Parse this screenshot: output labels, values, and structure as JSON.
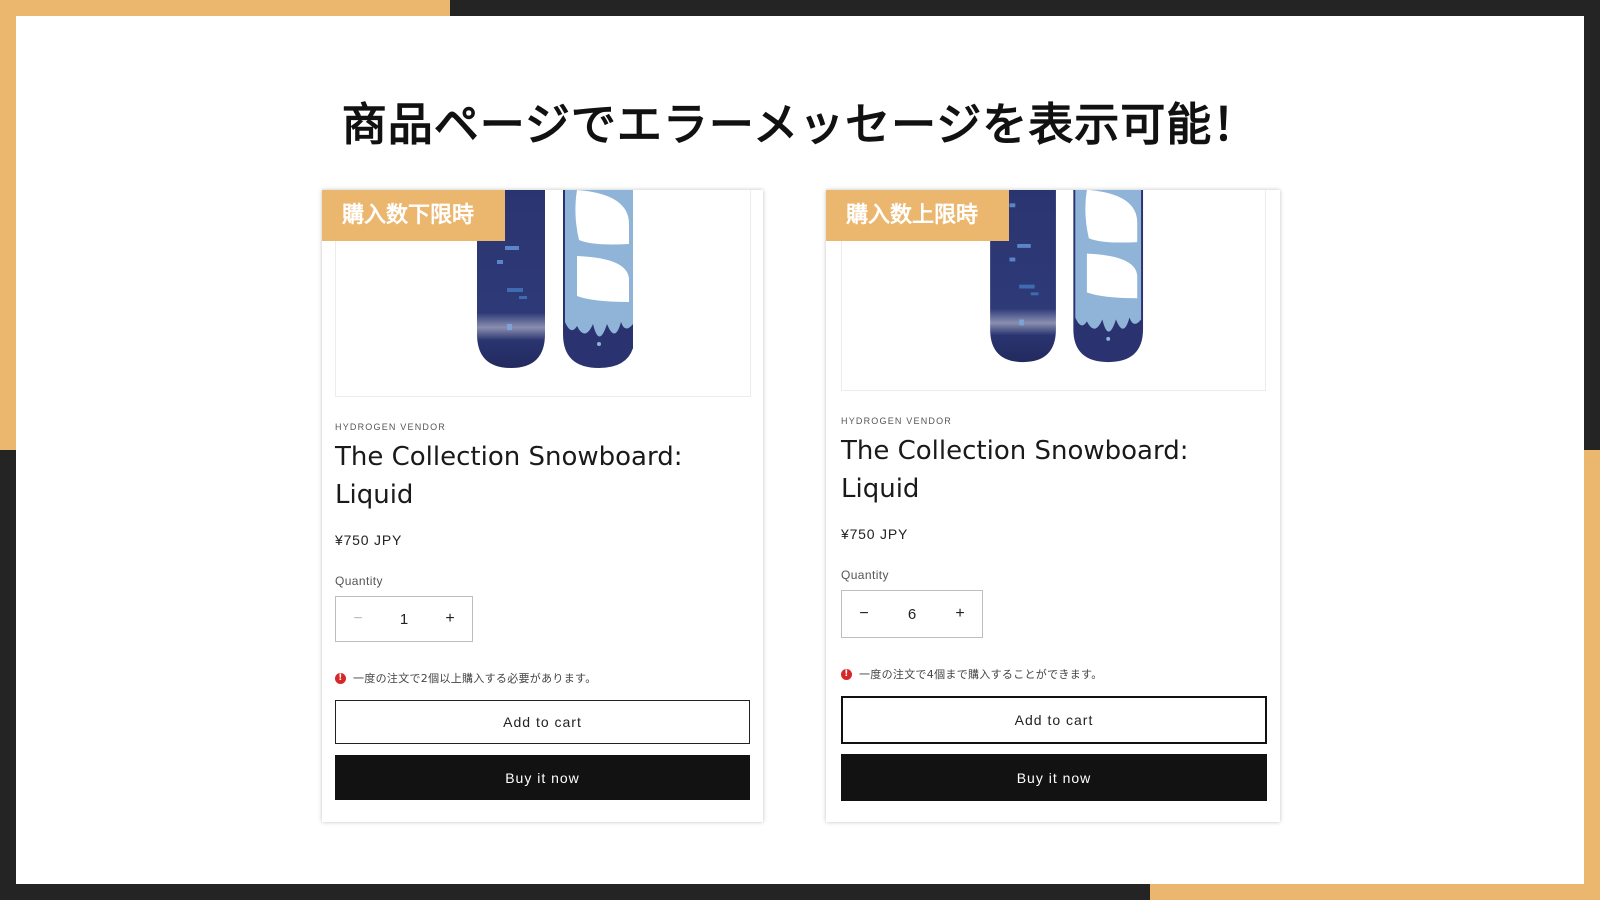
{
  "slide": {
    "title": "商品ページでエラーメッセージを表示可能！"
  },
  "cards": [
    {
      "ribbon": "購入数下限時",
      "vendor": "HYDROGEN VENDOR",
      "product_title": "The Collection Snowboard: Liquid",
      "price": "¥750 JPY",
      "quantity_label": "Quantity",
      "quantity_value": "1",
      "decrement": "−",
      "increment": "+",
      "error_message": "一度の注文で2個以上購入する必要があります。",
      "add_to_cart": "Add to cart",
      "buy_now": "Buy it now"
    },
    {
      "ribbon": "購入数上限時",
      "vendor": "HYDROGEN VENDOR",
      "product_title": "The Collection Snowboard: Liquid",
      "price": "¥750 JPY",
      "quantity_label": "Quantity",
      "quantity_value": "6",
      "decrement": "−",
      "increment": "+",
      "error_message": "一度の注文で4個まで購入することができます。",
      "add_to_cart": "Add to cart",
      "buy_now": "Buy it now"
    }
  ],
  "icons": {
    "error": "error-circle-icon",
    "product_image": "snowboard-image"
  },
  "colors": {
    "accent": "#ebb66e",
    "frame": "#242424",
    "error": "#d62828",
    "button_dark": "#121212"
  }
}
